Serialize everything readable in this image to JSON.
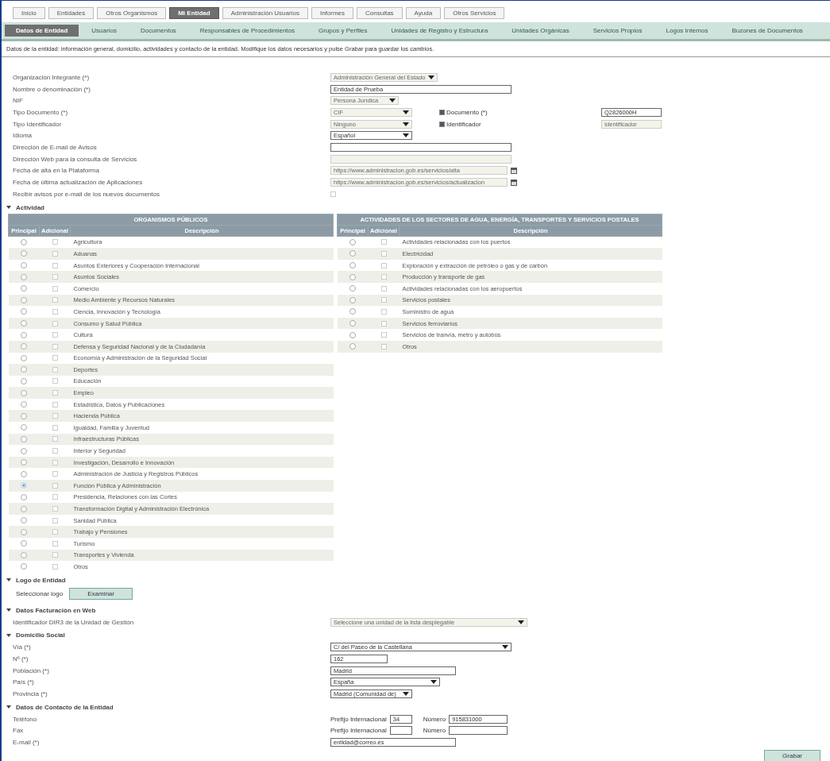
{
  "top_tabs": [
    {
      "label": "Inicio",
      "selected": false
    },
    {
      "label": "Entidades",
      "selected": false
    },
    {
      "label": "Otros Organismos",
      "selected": false
    },
    {
      "label": "Mi Entidad",
      "selected": true
    },
    {
      "label": "Administración Usuarios",
      "selected": false
    },
    {
      "label": "Informes",
      "selected": false
    },
    {
      "label": "Consultas",
      "selected": false
    },
    {
      "label": "Ayuda",
      "selected": false
    },
    {
      "label": "Otros Servicios",
      "selected": false
    }
  ],
  "sub_tabs": [
    {
      "label": "Datos de Entidad",
      "selected": true
    },
    {
      "label": "Usuarios",
      "selected": false
    },
    {
      "label": "Documentos",
      "selected": false
    },
    {
      "label": "Responsables de Procedimientos",
      "selected": false
    },
    {
      "label": "Grupos y Perfiles",
      "selected": false
    },
    {
      "label": "Unidades de Registro y Estructura",
      "selected": false
    },
    {
      "label": "Unidades Orgánicas",
      "selected": false
    },
    {
      "label": "Servicios Propios",
      "selected": false
    },
    {
      "label": "Logos Internos",
      "selected": false
    },
    {
      "label": "Buzones de Documentos",
      "selected": false
    }
  ],
  "intro": "Datos de la entidad: información general, domicilio, actividades y contacto de la entidad. Modifique los datos necesarios y pulse Grabar para guardar los cambios.",
  "fields": [
    {
      "label": "Organización Integrante (*)",
      "kind": "select",
      "value": "Administración General del Estado",
      "disabled": true
    },
    {
      "label": "Nombre o denominación (*)",
      "kind": "text",
      "value": "Entidad de Prueba",
      "disabled": false
    },
    {
      "label": "NIF",
      "kind": "select",
      "value": "Persona Jurídica",
      "disabled": true
    },
    {
      "label": "Tipo Documento (*)",
      "kind": "select",
      "value": "CIF",
      "disabled": true,
      "option": {
        "label": "Documento (*)",
        "checked": true,
        "value": "Q2826000H",
        "disabled": false
      }
    },
    {
      "label": "Tipo Identificador",
      "kind": "select",
      "value": "Ninguno",
      "disabled": true,
      "option": {
        "label": "Identificador",
        "checked": true,
        "value": "Identificador",
        "disabled": true
      }
    },
    {
      "label": "Idioma",
      "kind": "select",
      "value": "Español",
      "disabled": false
    },
    {
      "label": "Dirección de E-mail de Avisos",
      "kind": "text",
      "disabled": false
    },
    {
      "label": "Dirección Web para la consulta de Servicios",
      "kind": "text",
      "disabled": true
    },
    {
      "label": "Fecha de alta en la Plataforma",
      "kind": "date",
      "value": "https://www.administracion.gob.es/servicios/alta",
      "disabled": true
    },
    {
      "label": "Fecha de última actualización de Aplicaciones",
      "kind": "date",
      "value": "https://www.administracion.gob.es/servicios/actualizacion",
      "disabled": true
    },
    {
      "label": "Recibir avisos por e-mail de los nuevos documentos",
      "kind": "checkbox",
      "checked": false,
      "disabled": true
    }
  ],
  "activity": {
    "title": "Actividad",
    "tables": [
      {
        "title": "ORGANISMOS PÚBLICOS",
        "columns": [
          "Principal",
          "Adicional",
          "Descripción"
        ],
        "rows": [
          {
            "description": "Agricultura",
            "selected": false,
            "checked": false
          },
          {
            "description": "Aduanas",
            "selected": false,
            "checked": false
          },
          {
            "description": "Asuntos Exteriores y Cooperación Internacional",
            "selected": false,
            "checked": false
          },
          {
            "description": "Asuntos Sociales",
            "selected": false,
            "checked": false
          },
          {
            "description": "Comercio",
            "selected": false,
            "checked": false
          },
          {
            "description": "Medio Ambiente y Recursos Naturales",
            "selected": false,
            "checked": false
          },
          {
            "description": "Ciencia, Innovación y Tecnología",
            "selected": false,
            "checked": false
          },
          {
            "description": "Consumo y Salud Pública",
            "selected": false,
            "checked": false
          },
          {
            "description": "Cultura",
            "selected": false,
            "checked": false
          },
          {
            "description": "Defensa y Seguridad Nacional y de la Ciudadanía",
            "selected": false,
            "checked": false
          },
          {
            "description": "Economía y Administración de la Seguridad Social",
            "selected": false,
            "checked": false
          },
          {
            "description": "Deportes",
            "selected": false,
            "checked": false
          },
          {
            "description": "Educación",
            "selected": false,
            "checked": false
          },
          {
            "description": "Empleo",
            "selected": false,
            "checked": false
          },
          {
            "description": "Estadística, Datos y Publicaciones",
            "selected": false,
            "checked": false
          },
          {
            "description": "Hacienda Pública",
            "selected": false,
            "checked": false
          },
          {
            "description": "Igualdad, Familia y Juventud",
            "selected": false,
            "checked": false
          },
          {
            "description": "Infraestructuras Públicas",
            "selected": false,
            "checked": false
          },
          {
            "description": "Interior y Seguridad",
            "selected": false,
            "checked": false
          },
          {
            "description": "Investigación, Desarrollo e Innovación",
            "selected": false,
            "checked": false
          },
          {
            "description": "Administración de Justicia y Registros Públicos",
            "selected": false,
            "checked": false
          },
          {
            "description": "Función Pública y Administración",
            "selected": true,
            "checked": false
          },
          {
            "description": "Presidencia, Relaciones con las Cortes",
            "selected": false,
            "checked": false
          },
          {
            "description": "Transformación Digital y Administración Electrónica",
            "selected": false,
            "checked": false
          },
          {
            "description": "Sanidad Pública",
            "selected": false,
            "checked": false
          },
          {
            "description": "Trabajo y Pensiones",
            "selected": false,
            "checked": false
          },
          {
            "description": "Turismo",
            "selected": false,
            "checked": false
          },
          {
            "description": "Transportes y Vivienda",
            "selected": false,
            "checked": false
          },
          {
            "description": "Otros",
            "selected": false,
            "checked": false
          }
        ]
      },
      {
        "title": "ACTIVIDADES DE LOS SECTORES DE AGUA, ENERGÍA, TRANSPORTES Y SERVICIOS POSTALES",
        "columns": [
          "Principal",
          "Adicional",
          "Descripción"
        ],
        "rows": [
          {
            "description": "Actividades relacionadas con los puertos",
            "selected": false,
            "checked": false
          },
          {
            "description": "Electricidad",
            "selected": false,
            "checked": false
          },
          {
            "description": "Exploración y extracción de petróleo o gas y de carbón",
            "selected": false,
            "checked": false
          },
          {
            "description": "Producción y transporte de gas",
            "selected": false,
            "checked": false
          },
          {
            "description": "Actividades relacionadas con los aeropuertos",
            "selected": false,
            "checked": false
          },
          {
            "description": "Servicios postales",
            "selected": false,
            "checked": false
          },
          {
            "description": "Suministro de agua",
            "selected": false,
            "checked": false
          },
          {
            "description": "Servicios ferroviarios",
            "selected": false,
            "checked": false
          },
          {
            "description": "Servicios de tranvía, metro y autobús",
            "selected": false,
            "checked": false
          },
          {
            "description": "Otros",
            "selected": false,
            "checked": false
          }
        ]
      }
    ]
  },
  "logo": {
    "title": "Logo de Entidad",
    "label": "Seleccionar logo",
    "button": "Examinar"
  },
  "web": {
    "title": "Datos Facturación en Web",
    "label": "Identificador DIR3 de la Unidad de Gestión",
    "value": "Seleccione una unidad de la lista desplegable"
  },
  "address": {
    "title": "Domicilio Social",
    "fields": [
      {
        "label": "Vía (*)",
        "kind": "select",
        "value": "C/ del Paseo de la Castellana",
        "disabled": false
      },
      {
        "label": "Nº (*)",
        "kind": "text",
        "value": "162",
        "disabled": false
      },
      {
        "label": "Población (*)",
        "kind": "text",
        "value": "Madrid",
        "disabled": false
      },
      {
        "label": "País (*)",
        "kind": "select",
        "value": "España",
        "disabled": false
      },
      {
        "label": "Provincia (*)",
        "kind": "select",
        "value": "Madrid (Comunidad de)",
        "disabled": false
      }
    ]
  },
  "contact": {
    "title": "Datos de Contacto de la Entidad",
    "phones": [
      {
        "label": "Teléfono",
        "prefix_label": "Prefijo Internacional",
        "prefix": "34",
        "number_label": "Número",
        "number": "915831000"
      },
      {
        "label": "Fax",
        "prefix_label": "Prefijo Internacional",
        "number_label": "Número"
      }
    ],
    "email": {
      "label": "E-mail (*)",
      "value": "entidad@correo.es"
    }
  },
  "save_button": "Grabar"
}
